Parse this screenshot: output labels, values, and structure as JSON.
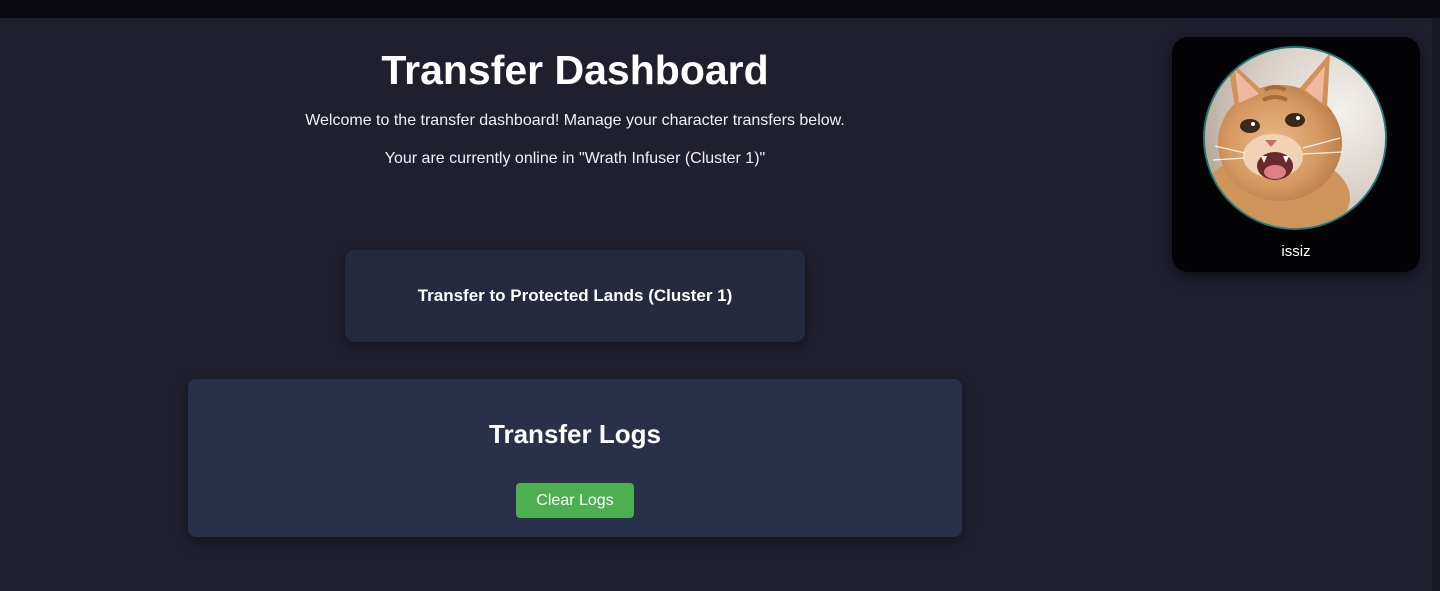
{
  "header": {
    "title": "Transfer Dashboard",
    "welcome": "Welcome to the transfer dashboard! Manage your character transfers below.",
    "status": "Your are currently online in \"Wrath Infuser (Cluster 1)\""
  },
  "actions": {
    "transfer_label": "Transfer to Protected Lands (Cluster 1)"
  },
  "logs": {
    "title": "Transfer Logs",
    "clear_label": "Clear Logs"
  },
  "profile": {
    "username": "issiz",
    "avatar_icon": "kitten-photo"
  },
  "colors": {
    "background": "#1f1f2e",
    "card": "#2a2f4a",
    "button_green": "#4caf50",
    "avatar_border": "#1f7a7a"
  }
}
